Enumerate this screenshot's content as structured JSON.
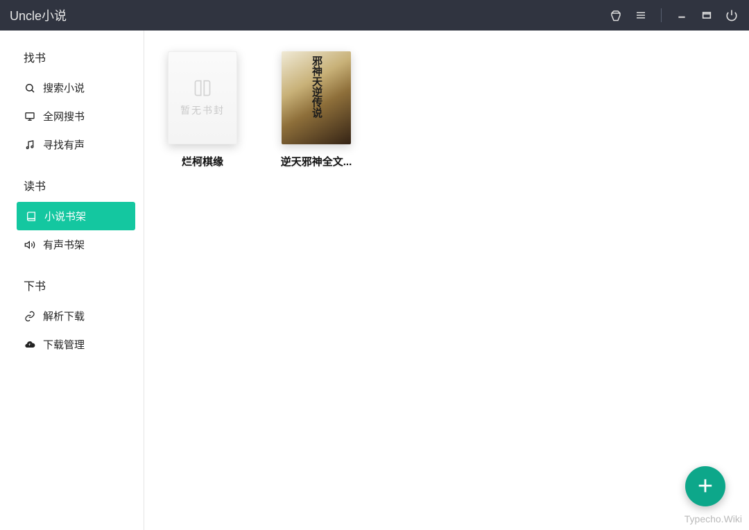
{
  "app": {
    "title": "Uncle小说"
  },
  "sidebar": {
    "sections": [
      {
        "header": "找书",
        "items": [
          {
            "icon": "search-icon",
            "label": "搜索小说"
          },
          {
            "icon": "monitor-icon",
            "label": "全网搜书"
          },
          {
            "icon": "music-icon",
            "label": "寻找有声"
          }
        ]
      },
      {
        "header": "读书",
        "items": [
          {
            "icon": "book-icon",
            "label": "小说书架",
            "active": true
          },
          {
            "icon": "volume-icon",
            "label": "有声书架"
          }
        ]
      },
      {
        "header": "下书",
        "items": [
          {
            "icon": "link-icon",
            "label": "解析下载"
          },
          {
            "icon": "cloud-download-icon",
            "label": "下载管理"
          }
        ]
      }
    ]
  },
  "shelf": {
    "books": [
      {
        "title": "烂柯棋缘",
        "cover_type": "placeholder",
        "placeholder_text": "暂无书封"
      },
      {
        "title": "逆天邪神全文...",
        "cover_type": "art",
        "cover_text": "邪神天逆传说"
      }
    ]
  },
  "fab": {
    "label": "+"
  },
  "watermark": "Typecho.Wiki"
}
